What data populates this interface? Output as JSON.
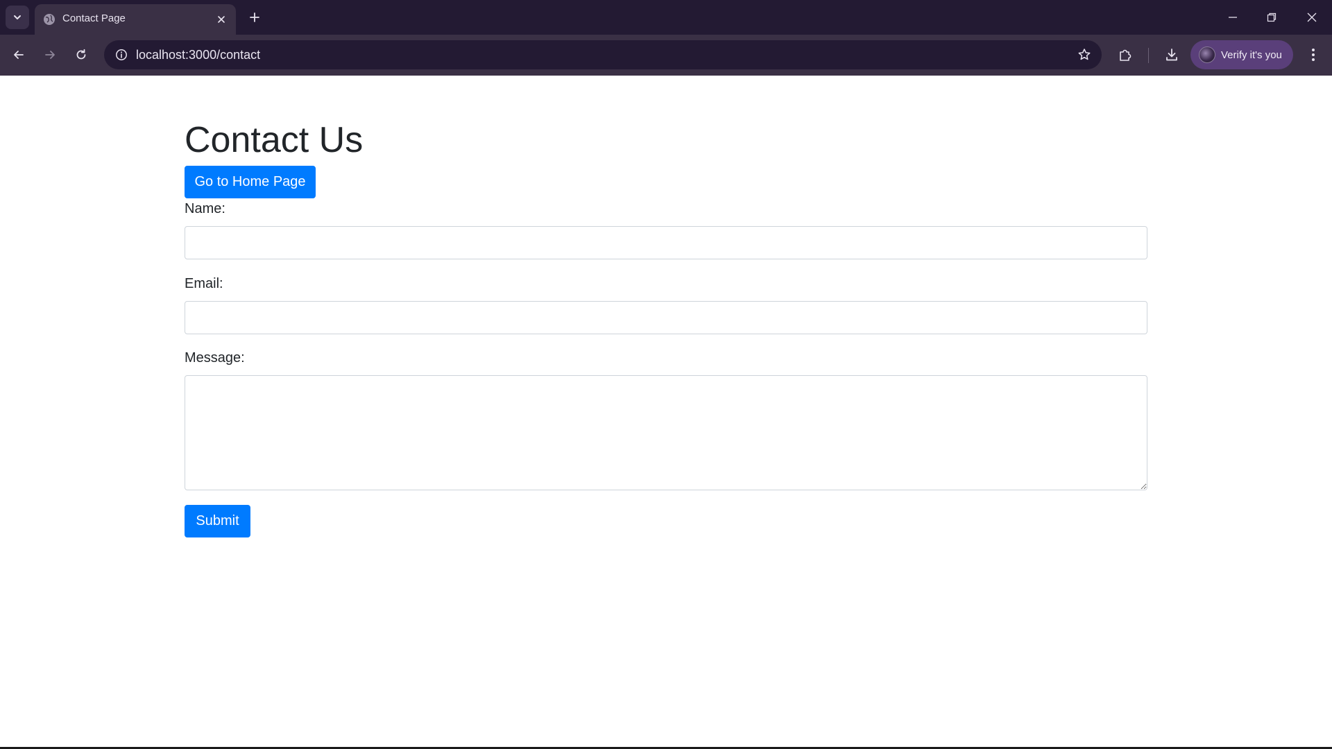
{
  "browser": {
    "tab": {
      "title": "Contact Page"
    },
    "url": "localhost:3000/contact",
    "profile": {
      "label": "Verify it's you"
    },
    "icons": {
      "tab_search": "chevron-down-icon",
      "favicon": "globe-icon",
      "tab_close": "close-icon",
      "new_tab": "plus-icon",
      "back": "arrow-left-icon",
      "forward": "arrow-right-icon",
      "reload": "reload-icon",
      "site_info": "info-icon",
      "bookmark": "star-icon",
      "extensions": "puzzle-icon",
      "downloads": "download-icon",
      "menu": "kebab-menu-icon",
      "minimize": "minimize-icon",
      "restore": "restore-icon",
      "close_window": "close-icon"
    },
    "colors": {
      "tabbar": "#231a33",
      "toolbar": "#3a3045",
      "profile_chip": "#5a3f7a"
    }
  },
  "page": {
    "title": "Contact Us",
    "home_button": "Go to Home Page",
    "form": {
      "name_label": "Name:",
      "name_value": "",
      "email_label": "Email:",
      "email_value": "",
      "message_label": "Message:",
      "message_value": "",
      "submit_label": "Submit"
    },
    "colors": {
      "primary": "#007bff",
      "text": "#212529",
      "input_border": "#ced4da"
    }
  }
}
